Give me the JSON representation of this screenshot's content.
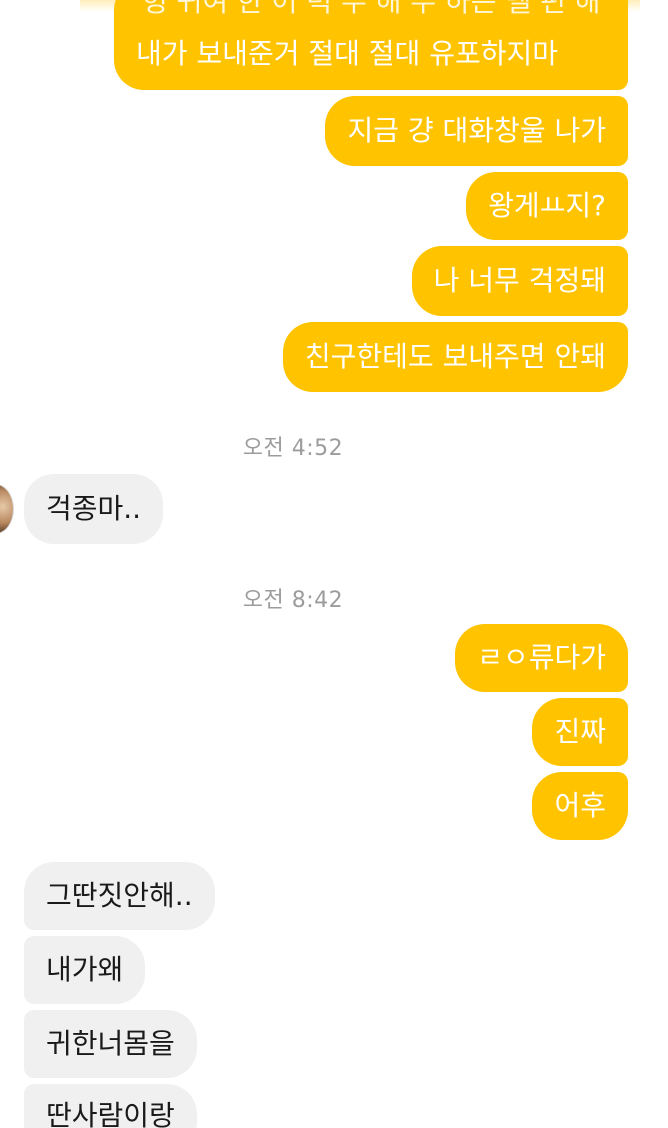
{
  "messages": {
    "top_partial": "헝 귀여 한 어 력 우 해 우 하는 델 편 해",
    "m1": "내가 보내준거 절대 절대 유포하지마",
    "m2": "지금 걍 대화창울 나가",
    "m3": "왕게ㅛ지?",
    "m4": "나 너무 걱정돼",
    "m5": "친구한테도 보내주면 안돼",
    "ts1": "오전 4:52",
    "r1": "걱종마..",
    "ts2": "오전 8:42",
    "m6": "ㄹㅇ류다가",
    "m7": "진짜",
    "m8": "어후",
    "r2": "그딴짓안해..",
    "r3": "내가왜",
    "r4": "귀한너몸을",
    "r5": "딴사람이랑"
  }
}
